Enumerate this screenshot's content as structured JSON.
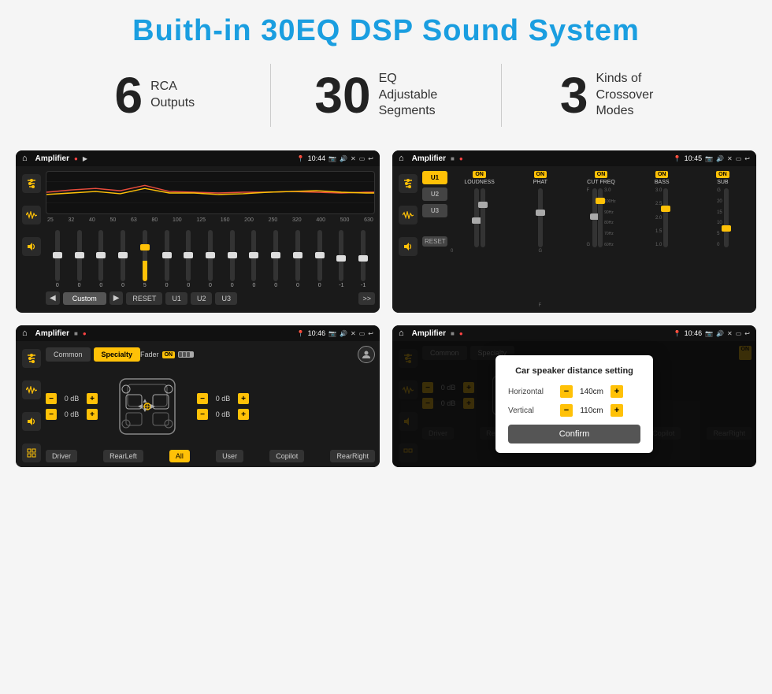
{
  "page": {
    "title": "Buith-in 30EQ DSP Sound System",
    "background": "#f5f5f5"
  },
  "stats": [
    {
      "number": "6",
      "label": "RCA\nOutputs"
    },
    {
      "number": "30",
      "label": "EQ Adjustable\nSegments"
    },
    {
      "number": "3",
      "label": "Kinds of\nCrossover Modes"
    }
  ],
  "screens": [
    {
      "id": "eq-screen",
      "time": "10:44",
      "app": "Amplifier",
      "description": "30-band EQ equalizer screen"
    },
    {
      "id": "crossover-screen",
      "time": "10:45",
      "app": "Amplifier",
      "description": "Crossover modes screen with U1/U2/U3 presets"
    },
    {
      "id": "specialty-screen",
      "time": "10:46",
      "app": "Amplifier",
      "description": "Common/Specialty tabs with speaker fader"
    },
    {
      "id": "dialog-screen",
      "time": "10:46",
      "app": "Amplifier",
      "description": "Car speaker distance setting dialog"
    }
  ],
  "eq": {
    "frequencies": [
      "25",
      "32",
      "40",
      "50",
      "63",
      "80",
      "100",
      "125",
      "160",
      "200",
      "250",
      "320",
      "400",
      "500",
      "630"
    ],
    "values": [
      "0",
      "0",
      "0",
      "0",
      "5",
      "0",
      "0",
      "0",
      "0",
      "0",
      "0",
      "0",
      "0",
      "-1",
      "0",
      "-1"
    ],
    "preset": "Custom",
    "buttons": [
      "RESET",
      "U1",
      "U2",
      "U3"
    ]
  },
  "crossover": {
    "presets": [
      "U1",
      "U2",
      "U3"
    ],
    "controls": [
      {
        "label": "LOUDNESS",
        "on": true
      },
      {
        "label": "PHAT",
        "on": true
      },
      {
        "label": "CUT FREQ",
        "on": true
      },
      {
        "label": "BASS",
        "on": true
      },
      {
        "label": "SUB",
        "on": true
      }
    ],
    "reset_label": "RESET"
  },
  "specialty": {
    "tabs": [
      "Common",
      "Specialty"
    ],
    "active_tab": "Specialty",
    "fader_label": "Fader",
    "fader_on": true,
    "db_values": [
      "0 dB",
      "0 dB",
      "0 dB",
      "0 dB"
    ],
    "buttons": [
      "Driver",
      "RearLeft",
      "All",
      "Copilot",
      "RearRight",
      "User"
    ]
  },
  "dialog": {
    "title": "Car speaker distance setting",
    "horizontal_label": "Horizontal",
    "horizontal_value": "140cm",
    "vertical_label": "Vertical",
    "vertical_value": "110cm",
    "confirm_label": "Confirm"
  }
}
